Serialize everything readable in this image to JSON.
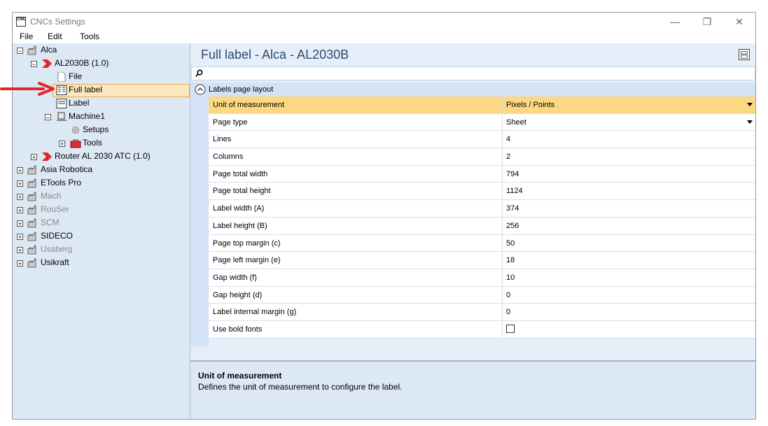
{
  "window": {
    "title": "CNCs Settings",
    "app_icon_text": "CNC",
    "minimize": "—",
    "restore": "❐",
    "close": "✕"
  },
  "menu": [
    "File",
    "Edit",
    "Tools"
  ],
  "tree": {
    "nodes": [
      {
        "label": "Alca"
      },
      {
        "label": "AL2030B (1.0)"
      },
      {
        "label": "File"
      },
      {
        "label": "Full label"
      },
      {
        "label": "Label"
      },
      {
        "label": "Machine1"
      },
      {
        "label": "Setups"
      },
      {
        "label": "Tools"
      },
      {
        "label": "Router AL 2030 ATC (1.0)"
      },
      {
        "label": "Asia Robotica"
      },
      {
        "label": "ETools Pro"
      },
      {
        "label": "Mach"
      },
      {
        "label": "RouSer"
      },
      {
        "label": "SCM"
      },
      {
        "label": "SIDECO"
      },
      {
        "label": "Usaberg"
      },
      {
        "label": "Usikraft"
      }
    ]
  },
  "panel": {
    "title": "Full label - Alca - AL2030B",
    "category": "Labels page layout",
    "properties": [
      {
        "name": "Unit of measurement",
        "value": "Pixels / Points"
      },
      {
        "name": "Page type",
        "value": "Sheet"
      },
      {
        "name": "Lines",
        "value": "4"
      },
      {
        "name": "Columns",
        "value": "2"
      },
      {
        "name": "Page total width",
        "value": "794"
      },
      {
        "name": "Page total height",
        "value": "1124"
      },
      {
        "name": "Label width (A)",
        "value": "374"
      },
      {
        "name": "Label height (B)",
        "value": "256"
      },
      {
        "name": "Page top margin (c)",
        "value": "50"
      },
      {
        "name": "Page left margin (e)",
        "value": "18"
      },
      {
        "name": "Gap width (f)",
        "value": "10"
      },
      {
        "name": "Gap height (d)",
        "value": "0"
      },
      {
        "name": "Label internal margin (g)",
        "value": "0"
      },
      {
        "name": "Use bold fonts",
        "value": ""
      }
    ],
    "description": {
      "title": "Unit of measurement",
      "text": "Defines the unit of measurement to configure the label."
    }
  },
  "colors": {
    "accent_red": "#e3262b",
    "selection": "#fde7bf",
    "selected_row": "#fcd882",
    "tree_bg": "#dde8f5"
  }
}
